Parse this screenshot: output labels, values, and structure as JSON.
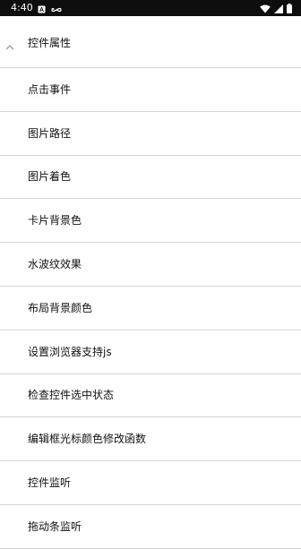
{
  "status_bar": {
    "time": "4:40",
    "icons": [
      "notification-a-icon",
      "notification-infinity-icon",
      "wifi-icon",
      "signal-icon",
      "battery-icon"
    ],
    "background": "#0e0e0e"
  },
  "group": {
    "title": "控件属性",
    "expanded": true,
    "items": [
      {
        "label": "点击事件"
      },
      {
        "label": "图片路径"
      },
      {
        "label": "图片着色"
      },
      {
        "label": "卡片背景色"
      },
      {
        "label": "水波纹效果"
      },
      {
        "label": "布局背景颜色"
      },
      {
        "label": "设置浏览器支持js"
      },
      {
        "label": "检查控件选中状态"
      },
      {
        "label": "编辑框光标颜色修改函数"
      },
      {
        "label": "控件监听"
      },
      {
        "label": "拖动条监听"
      }
    ]
  },
  "colors": {
    "divider": "#d6d6d6",
    "text": "#111111",
    "background": "#ffffff"
  }
}
